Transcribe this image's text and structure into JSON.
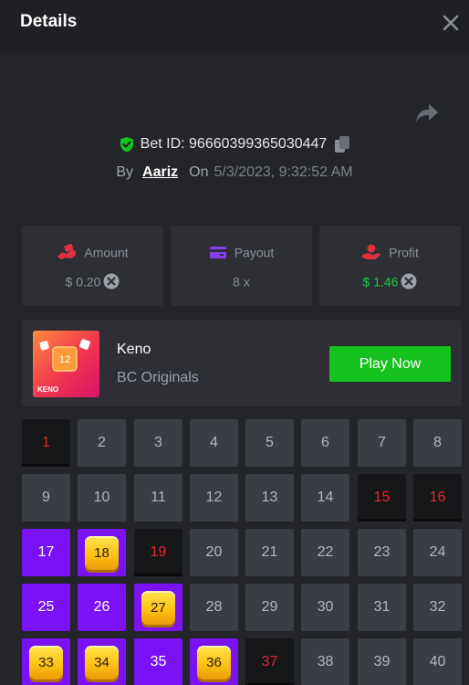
{
  "header": {
    "title": "Details",
    "close_icon": "close-icon"
  },
  "bet": {
    "id_label": "Bet ID:",
    "id_value": "96660399365030447",
    "by_label": "By",
    "user": "Aariz",
    "on_label": "On",
    "date": "5/3/2023, 9:32:52 AM"
  },
  "stats": {
    "amount": {
      "label": "Amount",
      "value": "$ 0.20"
    },
    "payout": {
      "label": "Payout",
      "value": "8 x"
    },
    "profit": {
      "label": "Profit",
      "value": "$ 1.46"
    }
  },
  "game": {
    "name": "Keno",
    "provider": "BC Originals",
    "thumb_number": "12",
    "thumb_label": "KENO",
    "play_label": "Play Now"
  },
  "board": {
    "numbers": [
      "1",
      "2",
      "3",
      "4",
      "5",
      "6",
      "7",
      "8",
      "9",
      "10",
      "11",
      "12",
      "13",
      "14",
      "15",
      "16",
      "17",
      "18",
      "19",
      "20",
      "21",
      "22",
      "23",
      "24",
      "25",
      "26",
      "27",
      "28",
      "29",
      "30",
      "31",
      "32",
      "33",
      "34",
      "35",
      "36",
      "37",
      "38",
      "39",
      "40"
    ],
    "misses": [
      1,
      15,
      16,
      19,
      37
    ],
    "picked": [
      17,
      18,
      25,
      26,
      27,
      33,
      34,
      35,
      36
    ],
    "gems": [
      18,
      27,
      33,
      34,
      36
    ]
  },
  "colors": {
    "accent_green": "#15c21f",
    "hit_purple": "#7b12f5",
    "miss_red": "#e3272f",
    "profit_green": "#22c93a",
    "amount_icon_red": "#e0303f",
    "payout_icon_purple": "#8a3cf0"
  }
}
